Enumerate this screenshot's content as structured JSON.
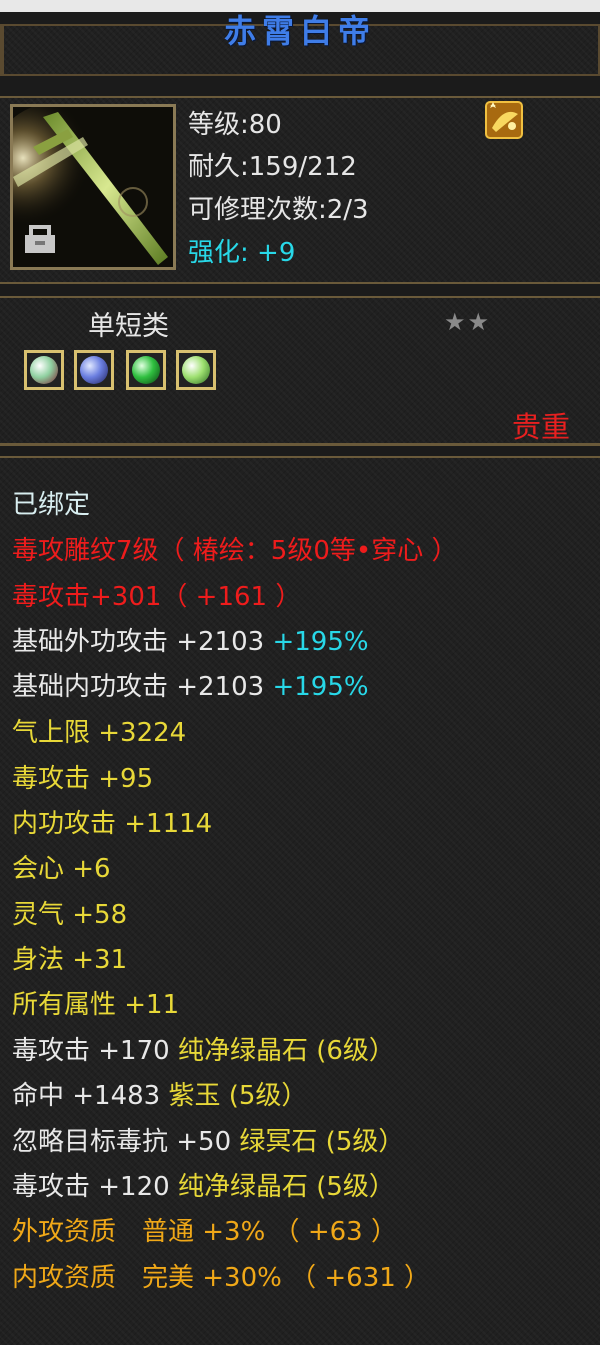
{
  "item": {
    "name": "赤霄白帝",
    "level": "等级:80",
    "durability": "耐久:159/212",
    "repair": "可修理次数:2/3",
    "enhance_label": "强化:",
    "enhance_value": "+9",
    "category": "单短类",
    "stars": "★★",
    "rarity": "贵重"
  },
  "gems": [
    {
      "name": "gem-slot-1",
      "color": "#8fd0a0"
    },
    {
      "name": "gem-slot-2",
      "color": "#6a7ee0"
    },
    {
      "name": "gem-slot-3",
      "color": "#30c040"
    },
    {
      "name": "gem-slot-4",
      "color": "#9ee070"
    }
  ],
  "details": {
    "bound": "已绑定",
    "engrave": "毒攻雕纹7级（ 椿绘：5级0等•穿心 ）",
    "poison_main": "毒攻击+301（ +161 ）",
    "ext_attack": "基础外功攻击 +2103",
    "ext_attack_pct": "+195%",
    "int_attack": "基础内功攻击 +2103",
    "int_attack_pct": "+195%",
    "stats": [
      "气上限 +3224",
      "毒攻击 +95",
      "内功攻击 +1114",
      "会心 +6",
      "灵气 +58",
      "身法 +31",
      "所有属性 +11"
    ],
    "gem_lines": [
      {
        "prefix": "毒攻击 +170 ",
        "gem": "纯净绿晶石 (6级）"
      },
      {
        "prefix": "命中 +1483 ",
        "gem": "紫玉 (5级）"
      },
      {
        "prefix": "忽略目标毒抗 +50 ",
        "gem": "绿冥石 (5级）"
      },
      {
        "prefix": "毒攻击 +120 ",
        "gem": "纯净绿晶石 (5级）"
      }
    ],
    "qualities": [
      "外攻资质　普通 +3% （ +63 ）",
      "内攻资质　完美 +30% （ +631 ）"
    ]
  },
  "colors": {
    "title": "#3f7de8",
    "red": "#ee1c1c",
    "yellow": "#e8d838",
    "orange": "#f0a818",
    "cyan": "#28d8e8"
  }
}
